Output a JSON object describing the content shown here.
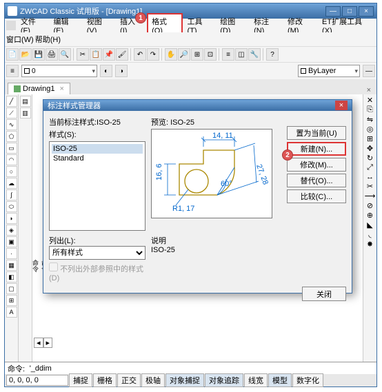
{
  "title": "ZWCAD Classic 试用版 - [Drawing1]",
  "menus1": [
    "文件(F)",
    "编辑(E)",
    "视图(V)",
    "插入(I)",
    "格式(O)",
    "工具(T)",
    "绘图(D)",
    "标注(N)",
    "修改(M)",
    "ET扩展工具(X)"
  ],
  "menus2": [
    "窗口(W)",
    "帮助(H)"
  ],
  "highlight_menu_index": 4,
  "tab": {
    "name": "Drawing1",
    "close": "×"
  },
  "layer_combo": "ByLayer",
  "osnap_tabs": [
    "捕捉",
    "栅格",
    "正交",
    "极轴",
    "对象捕捉",
    "对象追踪",
    "线宽",
    "模型",
    "数字化"
  ],
  "osnap_on": [
    4,
    5,
    7
  ],
  "coord": "0, 0, 0, 0",
  "cmdline_prefix": "命令:",
  "cmdline_value": "'_ddim",
  "dialog": {
    "title": "标注样式管理器",
    "cur_label": "当前标注样式:ISO-25",
    "styles_label": "样式(S):",
    "styles": [
      "ISO-25",
      "Standard"
    ],
    "preview_label": "预览: ISO-25",
    "buttons": [
      "置为当前(U)",
      "新建(N)...",
      "修改(M)...",
      "替代(O)...",
      "比较(C)..."
    ],
    "hl_button_index": 1,
    "list_label": "列出(L):",
    "list_value": "所有样式",
    "ext_chk": "不列出外部参照中的样式(D)",
    "desc_label": "说明",
    "desc_value": "ISO-25",
    "close": "关闭",
    "dims": {
      "top": "14, 11",
      "left": "16, 6",
      "right": "27, 28",
      "ang": "60°",
      "rad": "R1, 17"
    }
  },
  "badges": {
    "menu": "1",
    "newbtn": "2"
  }
}
